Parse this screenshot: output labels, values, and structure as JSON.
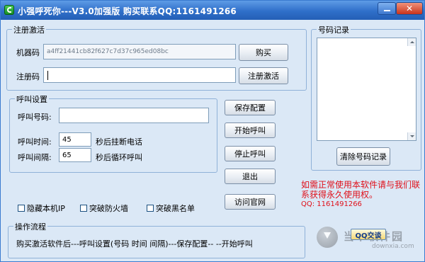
{
  "window": {
    "title": "小强呼死你---V3.0加强版 购买联系QQ:1161491266",
    "close_symbol": "✕"
  },
  "register": {
    "group_label": "注册激活",
    "machine_code_label": "机器码",
    "machine_code_value": "a4ff21441cb82f627c7d37c965ed08bc",
    "buy_button": "购买",
    "reg_code_label": "注册码",
    "reg_code_value": "",
    "activate_button": "注册激活"
  },
  "call_settings": {
    "group_label": "呼叫设置",
    "number_label": "呼叫号码:",
    "number_value": "",
    "call_time_label": "呼叫时间:",
    "call_time_value": "45",
    "call_time_suffix": "秒后挂断电话",
    "interval_label": "呼叫间隔:",
    "interval_value": "65",
    "interval_suffix": "秒后循环呼叫"
  },
  "actions": {
    "save_config": "保存配置",
    "start_call": "开始呼叫",
    "stop_call": "停止呼叫",
    "exit": "退出",
    "visit_site": "访问官网"
  },
  "options": {
    "hide_ip": "隐藏本机IP",
    "firewall": "突破防火墙",
    "blacklist": "突破黑名单"
  },
  "records": {
    "group_label": "号码记录",
    "clear_button": "清除号码记录"
  },
  "notice": {
    "text": "如需正常使用本软件请与我们联系获得永久使用权。",
    "qq": "QQ: 1161491266"
  },
  "process": {
    "group_label": "操作流程",
    "text": "购买激活软件后---呼叫设置(号码  时间 间隔)---保存配置-- --开始呼叫"
  },
  "overlay": {
    "qq_chat_button": "QQ交谈",
    "watermark_title": "当下软件园",
    "watermark_sub": "downxia.com"
  },
  "colors": {
    "window_bg": "#dbe8f6",
    "titlebar": "#2f6fc9",
    "notice_red": "#e0101a"
  }
}
